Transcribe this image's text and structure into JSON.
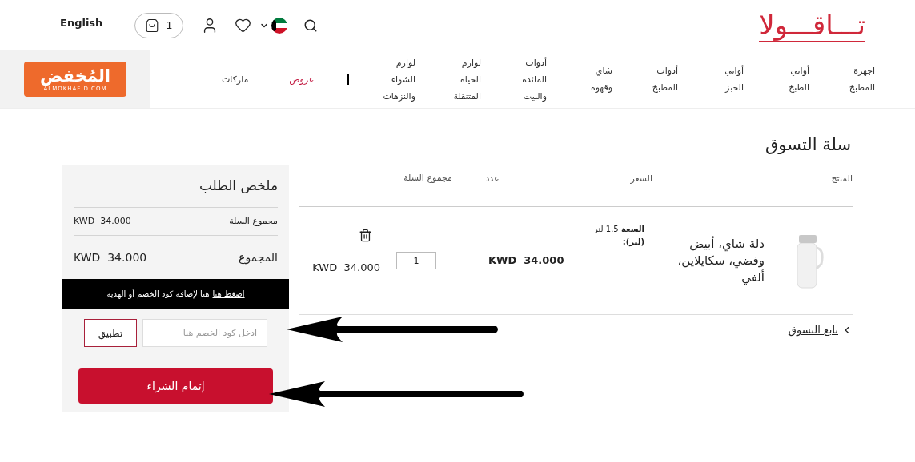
{
  "header": {
    "logo": "تـــاقـــولا",
    "language": "English",
    "cart_count": "1"
  },
  "partner_logo": {
    "name": "المُخفض",
    "site": "ALMOKHAFID.COM"
  },
  "nav": [
    {
      "label": "اجهزة المطبخ",
      "kind": "link",
      "highlighted": false
    },
    {
      "label": "أواني الطبخ",
      "kind": "link",
      "highlighted": false
    },
    {
      "label": "أواني الخبز",
      "kind": "link",
      "highlighted": false
    },
    {
      "label": "أدوات المطبخ",
      "kind": "link",
      "highlighted": false
    },
    {
      "label": "شاي وقهوة",
      "kind": "link",
      "highlighted": false
    },
    {
      "label": "أدوات المائدة والبيت",
      "kind": "link",
      "highlighted": false
    },
    {
      "label": "لوازم الحياة المتنقلة",
      "kind": "link",
      "highlighted": false
    },
    {
      "label": "لوازم الشواء والنزهات",
      "kind": "link",
      "highlighted": false
    },
    {
      "kind": "separator"
    },
    {
      "label": "عروض",
      "kind": "link",
      "highlighted": true
    },
    {
      "label": "ماركات",
      "kind": "link",
      "highlighted": false
    }
  ],
  "page_title": "سلة التسوق",
  "cart": {
    "columns": [
      "المنتج",
      "السعر",
      "عدد",
      "مجموع السلة"
    ],
    "rows": [
      {
        "name": "دلة شاي، أبيض وفضي، سكايلاين، ألفي",
        "attribute": "**السعة** 1.5 لتر **(لتر):**",
        "price": "KWD  34.000",
        "quantity": "1",
        "total": "KWD  34.000"
      }
    ],
    "continue": "تابع التسوق"
  },
  "summary": {
    "title": "ملخص الطلب",
    "subtotal_label": "مجموع السلة",
    "subtotal": "KWD  34.000",
    "total_label": "المجموع",
    "total": "KWD  34.000",
    "coupon_link": "اضغط هنا",
    "coupon_text": "هنا لإضافة كود الخصم أو الهدية",
    "coupon_placeholder": "ادخل كود الخصم هنا",
    "apply": "تطبيق",
    "checkout": "إتمام الشراء"
  }
}
